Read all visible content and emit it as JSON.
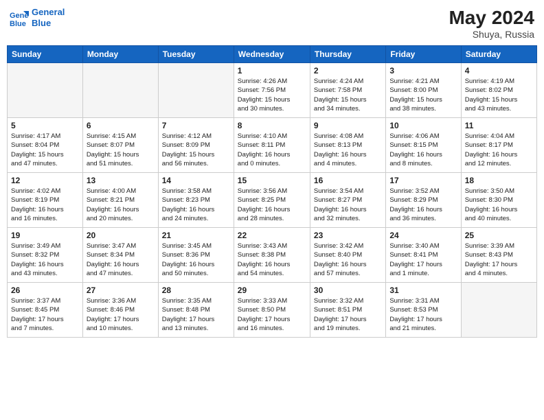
{
  "header": {
    "logo_line1": "General",
    "logo_line2": "Blue",
    "month": "May 2024",
    "location": "Shuya, Russia"
  },
  "days_of_week": [
    "Sunday",
    "Monday",
    "Tuesday",
    "Wednesday",
    "Thursday",
    "Friday",
    "Saturday"
  ],
  "weeks": [
    [
      {
        "num": "",
        "info": ""
      },
      {
        "num": "",
        "info": ""
      },
      {
        "num": "",
        "info": ""
      },
      {
        "num": "1",
        "info": "Sunrise: 4:26 AM\nSunset: 7:56 PM\nDaylight: 15 hours\nand 30 minutes."
      },
      {
        "num": "2",
        "info": "Sunrise: 4:24 AM\nSunset: 7:58 PM\nDaylight: 15 hours\nand 34 minutes."
      },
      {
        "num": "3",
        "info": "Sunrise: 4:21 AM\nSunset: 8:00 PM\nDaylight: 15 hours\nand 38 minutes."
      },
      {
        "num": "4",
        "info": "Sunrise: 4:19 AM\nSunset: 8:02 PM\nDaylight: 15 hours\nand 43 minutes."
      }
    ],
    [
      {
        "num": "5",
        "info": "Sunrise: 4:17 AM\nSunset: 8:04 PM\nDaylight: 15 hours\nand 47 minutes."
      },
      {
        "num": "6",
        "info": "Sunrise: 4:15 AM\nSunset: 8:07 PM\nDaylight: 15 hours\nand 51 minutes."
      },
      {
        "num": "7",
        "info": "Sunrise: 4:12 AM\nSunset: 8:09 PM\nDaylight: 15 hours\nand 56 minutes."
      },
      {
        "num": "8",
        "info": "Sunrise: 4:10 AM\nSunset: 8:11 PM\nDaylight: 16 hours\nand 0 minutes."
      },
      {
        "num": "9",
        "info": "Sunrise: 4:08 AM\nSunset: 8:13 PM\nDaylight: 16 hours\nand 4 minutes."
      },
      {
        "num": "10",
        "info": "Sunrise: 4:06 AM\nSunset: 8:15 PM\nDaylight: 16 hours\nand 8 minutes."
      },
      {
        "num": "11",
        "info": "Sunrise: 4:04 AM\nSunset: 8:17 PM\nDaylight: 16 hours\nand 12 minutes."
      }
    ],
    [
      {
        "num": "12",
        "info": "Sunrise: 4:02 AM\nSunset: 8:19 PM\nDaylight: 16 hours\nand 16 minutes."
      },
      {
        "num": "13",
        "info": "Sunrise: 4:00 AM\nSunset: 8:21 PM\nDaylight: 16 hours\nand 20 minutes."
      },
      {
        "num": "14",
        "info": "Sunrise: 3:58 AM\nSunset: 8:23 PM\nDaylight: 16 hours\nand 24 minutes."
      },
      {
        "num": "15",
        "info": "Sunrise: 3:56 AM\nSunset: 8:25 PM\nDaylight: 16 hours\nand 28 minutes."
      },
      {
        "num": "16",
        "info": "Sunrise: 3:54 AM\nSunset: 8:27 PM\nDaylight: 16 hours\nand 32 minutes."
      },
      {
        "num": "17",
        "info": "Sunrise: 3:52 AM\nSunset: 8:29 PM\nDaylight: 16 hours\nand 36 minutes."
      },
      {
        "num": "18",
        "info": "Sunrise: 3:50 AM\nSunset: 8:30 PM\nDaylight: 16 hours\nand 40 minutes."
      }
    ],
    [
      {
        "num": "19",
        "info": "Sunrise: 3:49 AM\nSunset: 8:32 PM\nDaylight: 16 hours\nand 43 minutes."
      },
      {
        "num": "20",
        "info": "Sunrise: 3:47 AM\nSunset: 8:34 PM\nDaylight: 16 hours\nand 47 minutes."
      },
      {
        "num": "21",
        "info": "Sunrise: 3:45 AM\nSunset: 8:36 PM\nDaylight: 16 hours\nand 50 minutes."
      },
      {
        "num": "22",
        "info": "Sunrise: 3:43 AM\nSunset: 8:38 PM\nDaylight: 16 hours\nand 54 minutes."
      },
      {
        "num": "23",
        "info": "Sunrise: 3:42 AM\nSunset: 8:40 PM\nDaylight: 16 hours\nand 57 minutes."
      },
      {
        "num": "24",
        "info": "Sunrise: 3:40 AM\nSunset: 8:41 PM\nDaylight: 17 hours\nand 1 minute."
      },
      {
        "num": "25",
        "info": "Sunrise: 3:39 AM\nSunset: 8:43 PM\nDaylight: 17 hours\nand 4 minutes."
      }
    ],
    [
      {
        "num": "26",
        "info": "Sunrise: 3:37 AM\nSunset: 8:45 PM\nDaylight: 17 hours\nand 7 minutes."
      },
      {
        "num": "27",
        "info": "Sunrise: 3:36 AM\nSunset: 8:46 PM\nDaylight: 17 hours\nand 10 minutes."
      },
      {
        "num": "28",
        "info": "Sunrise: 3:35 AM\nSunset: 8:48 PM\nDaylight: 17 hours\nand 13 minutes."
      },
      {
        "num": "29",
        "info": "Sunrise: 3:33 AM\nSunset: 8:50 PM\nDaylight: 17 hours\nand 16 minutes."
      },
      {
        "num": "30",
        "info": "Sunrise: 3:32 AM\nSunset: 8:51 PM\nDaylight: 17 hours\nand 19 minutes."
      },
      {
        "num": "31",
        "info": "Sunrise: 3:31 AM\nSunset: 8:53 PM\nDaylight: 17 hours\nand 21 minutes."
      },
      {
        "num": "",
        "info": ""
      }
    ]
  ]
}
